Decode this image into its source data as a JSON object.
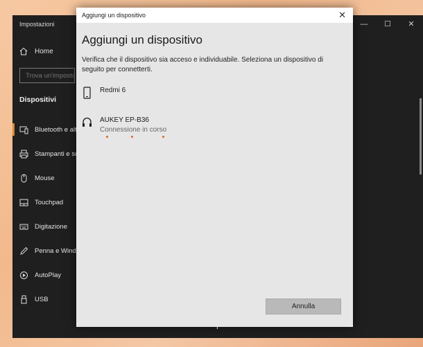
{
  "background_window": {
    "app_title": "Impostazioni",
    "controls": [
      "—",
      "☐",
      "✕"
    ],
    "home_label": "Home",
    "search_placeholder": "Trova un'impostazione",
    "section_title": "Dispositivi",
    "nav_items": [
      {
        "label": "Bluetooth e altri dispositivi",
        "icon": "bluetooth-device-icon"
      },
      {
        "label": "Stampanti e scanner",
        "icon": "printer-icon"
      },
      {
        "label": "Mouse",
        "icon": "mouse-icon"
      },
      {
        "label": "Touchpad",
        "icon": "touchpad-icon"
      },
      {
        "label": "Digitazione",
        "icon": "keyboard-icon"
      },
      {
        "label": "Penna e Windows Ink",
        "icon": "pen-icon"
      },
      {
        "label": "AutoPlay",
        "icon": "autoplay-icon"
      },
      {
        "label": "USB",
        "icon": "usb-icon"
      }
    ],
    "behind_text": "Altri dispositivi"
  },
  "dialog": {
    "titlebar": "Aggiungi un dispositivo",
    "close_label": "✕",
    "heading": "Aggiungi un dispositivo",
    "description": "Verifica che il dispositivo sia acceso e individuabile. Seleziona un dispositivo di seguito per connetterti.",
    "devices": [
      {
        "name": "Redmi 6",
        "status": "",
        "icon": "phone-icon"
      },
      {
        "name": "AUKEY EP-B36",
        "status": "Connessione in corso",
        "icon": "headset-icon"
      }
    ],
    "cancel_label": "Annulla"
  },
  "colors": {
    "accent": "#d98a3a",
    "progress": "#d9691e",
    "dark_bg": "#1f1f1f",
    "dialog_bg": "#e6e6e6"
  }
}
